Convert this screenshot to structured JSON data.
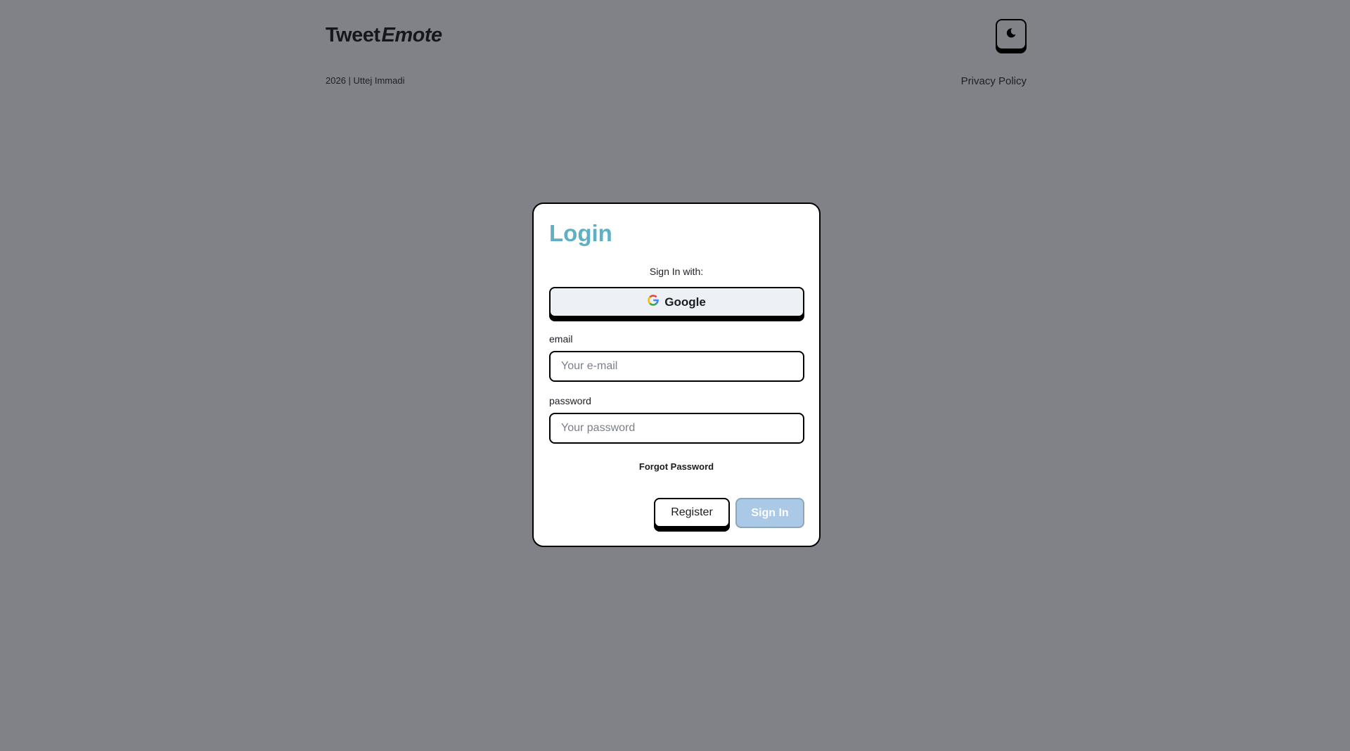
{
  "header": {
    "brand_part1": "Tweet",
    "brand_part2": "Emote",
    "theme_toggle_icon": "moon-icon"
  },
  "footer": {
    "copyright": "2026 | Uttej Immadi",
    "privacy_link": "Privacy Policy"
  },
  "login": {
    "title": "Login",
    "sign_in_with": "Sign In with:",
    "google_label": "Google",
    "email_label": "email",
    "email_placeholder": "Your e-mail",
    "password_label": "password",
    "password_placeholder": "Your password",
    "forgot_password": "Forgot Password",
    "register_label": "Register",
    "signin_label": "Sign In"
  },
  "colors": {
    "background": "#818287",
    "title_accent": "#5fb0c3",
    "google_button_bg": "#edf1f5",
    "signin_button_bg": "#a9c9e6"
  }
}
